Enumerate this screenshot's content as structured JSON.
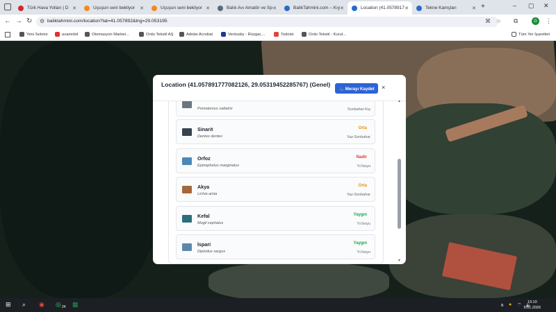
{
  "browser": {
    "tabs": [
      {
        "label": "Türk Hava Yolları | D",
        "color": "#d0272a"
      },
      {
        "label": "Uçuşun seni bekliyor",
        "color": "#f28b1e"
      },
      {
        "label": "Uçuşun seni bekliyor",
        "color": "#f28b1e"
      },
      {
        "label": "Balık Avı Amatör ve Sp",
        "color": "#5a6b7b"
      },
      {
        "label": "BalikTahmini.com – Kıy",
        "color": "#2a6ac9"
      },
      {
        "label": "Location (41.0578917",
        "color": "#2a6ac9"
      },
      {
        "label": "Tekne Kamçları",
        "color": "#2a6ac9"
      }
    ],
    "new_tab": "+",
    "url": "baliktahmini.com/location?lat=41.057892&lng=29.053195",
    "bookmarks": [
      {
        "label": "Yeni Sekme",
        "color": "#555"
      },
      {
        "label": "avamobil",
        "color": "#e0322a"
      },
      {
        "label": "Otomasyon Market...",
        "color": "#555"
      },
      {
        "label": "Ordu Tekstil AŞ",
        "color": "#555"
      },
      {
        "label": "Adobe Acrobat",
        "color": "#555"
      },
      {
        "label": "Ventusky - Rüzgar,...",
        "color": "#1a3c8c"
      },
      {
        "label": "Todoist",
        "color": "#e0443a"
      },
      {
        "label": "Ordu Tekstil - Kurul...",
        "color": "#555"
      }
    ],
    "all_bookmarks": "Tüm Yer İşaretleri",
    "profile_initial": "G"
  },
  "modal": {
    "title": "Location (41.057891777082126, 29.05319452285767) (Genel)",
    "save_label": "🎣 Merayı Kaydet",
    "close_label": "×",
    "partial_item": {
      "latin": "Pomatomus saltatrix",
      "season": "Sonbahar-Kış"
    },
    "fish": [
      {
        "name": "Sinarit",
        "latin": "Dentex dentex",
        "abundance": "Orta",
        "abundance_color": "#e8900c",
        "season": "Yaz-Sonbahar",
        "thumb": "#36424e"
      },
      {
        "name": "Orfoz",
        "latin": "Epinephelus marginatus",
        "abundance": "Nadir",
        "abundance_color": "#e03a3a",
        "season": "Yıl boyu",
        "thumb": "#4c88b8"
      },
      {
        "name": "Akya",
        "latin": "Lichia amia",
        "abundance": "Orta",
        "abundance_color": "#e8900c",
        "season": "Yaz-Sonbahar",
        "thumb": "#a4683c"
      },
      {
        "name": "Kefal",
        "latin": "Mugil cephalus",
        "abundance": "Yaygın",
        "abundance_color": "#1da34a",
        "season": "Yıl boyu",
        "thumb": "#2c6f7c"
      },
      {
        "name": "İspari",
        "latin": "Diplodus sargus",
        "abundance": "Yaygın",
        "abundance_color": "#1da34a",
        "season": "Yıl boyu",
        "thumb": "#5c88a8"
      }
    ]
  },
  "taskbar": {
    "time": "13:10",
    "date": "5.01.2026",
    "whatsapp_badge": "24"
  }
}
